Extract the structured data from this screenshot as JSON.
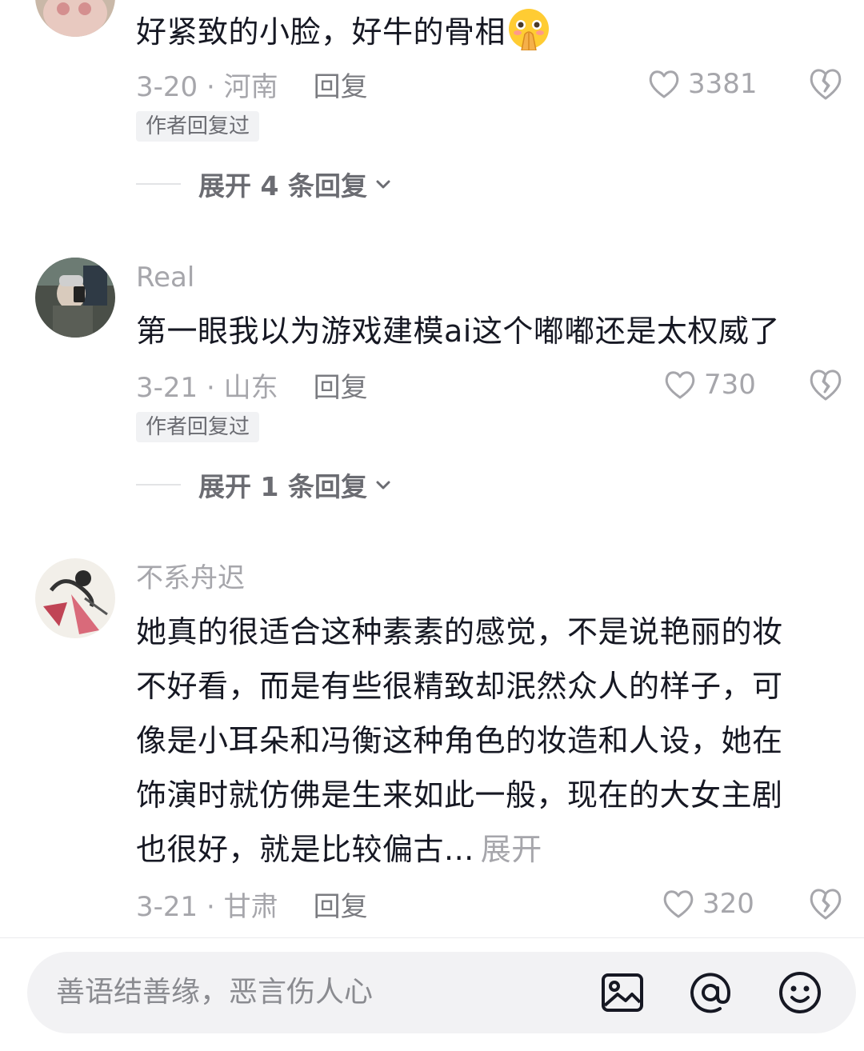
{
  "comments": [
    {
      "username": "",
      "text": "好紧致的小脸，好牛的骨相",
      "emoji": "praying-face-emoji",
      "date_location": "3-20 · 河南",
      "reply_label": "回复",
      "like_count": "3381",
      "badge": "作者回复过",
      "expand_label": "展开 4 条回复"
    },
    {
      "username": "Real",
      "text": "第一眼我以为游戏建模ai这个嘟嘟还是太权威了",
      "date_location": "3-21 · 山东",
      "reply_label": "回复",
      "like_count": "730",
      "badge": "作者回复过",
      "expand_label": "展开 1 条回复"
    },
    {
      "username": "不系舟迟",
      "text_lines": [
        "她真的很适合这种素素的感觉，不是说艳丽的妆",
        "不好看，而是有些很精致却泯然众人的样子，可",
        "像是小耳朵和冯衡这种角色的妆造和人设，她在",
        "饰演时就仿佛是生来如此一般，现在的大女主剧",
        "也很好，就是比较偏古..."
      ],
      "more_label": "展开",
      "date_location": "3-21 · 甘肃",
      "reply_label": "回复",
      "like_count": "320"
    }
  ],
  "input_bar": {
    "placeholder": "善语结善缘，恶言伤人心",
    "icons": [
      "image-icon",
      "at-icon",
      "emoji-icon"
    ]
  },
  "colors": {
    "text_primary": "#161823",
    "text_secondary": "#a6a6ab",
    "badge_bg": "#f1f2f4",
    "input_bg": "#f2f2f4"
  }
}
